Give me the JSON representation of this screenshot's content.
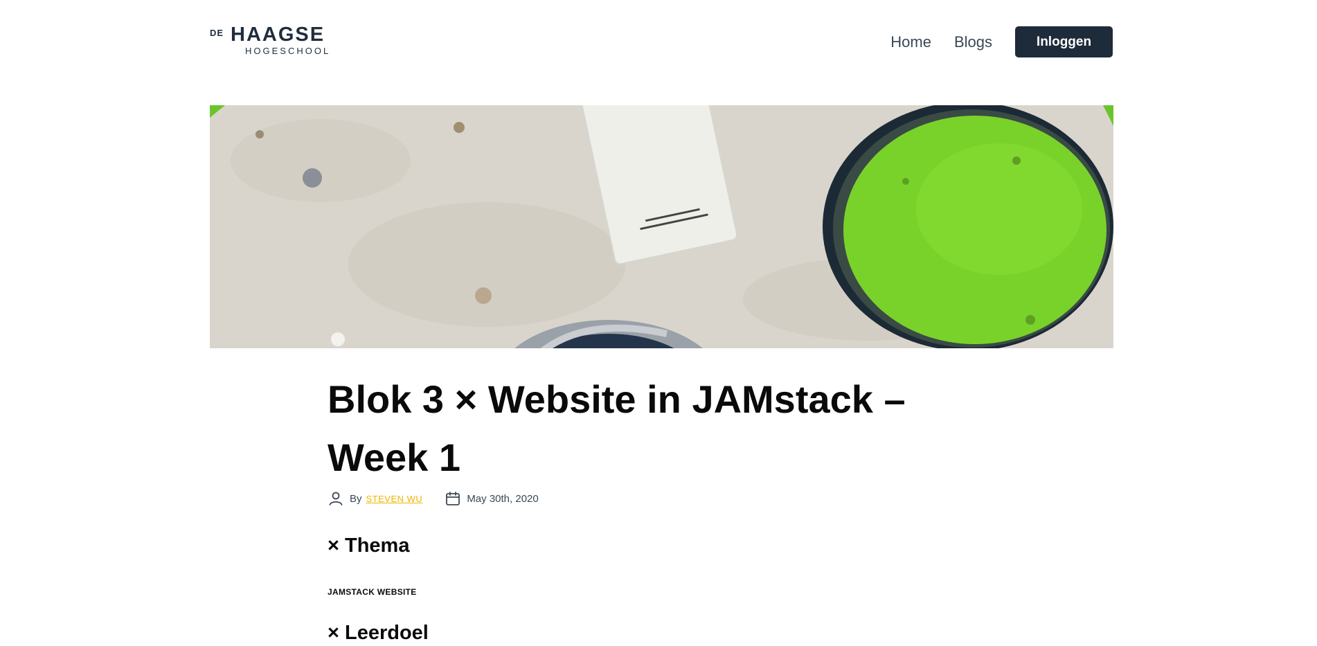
{
  "header": {
    "logo": {
      "prefix": "DE",
      "name": "HAAGSE",
      "sub": "HOGESCHOOL"
    },
    "nav": {
      "home": "Home",
      "blogs": "Blogs"
    },
    "login_label": "Inloggen"
  },
  "hero": {
    "image": "paint-cans-on-canvas"
  },
  "post": {
    "title": "Blok 3 × Website in JAMstack – Week 1",
    "meta": {
      "by": "By",
      "author": "STEVEN WU",
      "date": "May 30th, 2020",
      "author_icon": "user-icon",
      "date_icon": "calendar-icon"
    },
    "sections": {
      "thema_heading": "× Thema",
      "thema_label": "JAMSTACK WEBSITE",
      "leerdoel_heading": "× Leerdoel"
    }
  },
  "colors": {
    "accent": "#f0b400",
    "button": "#1e2b3a",
    "paint_green": "#79d22a"
  }
}
